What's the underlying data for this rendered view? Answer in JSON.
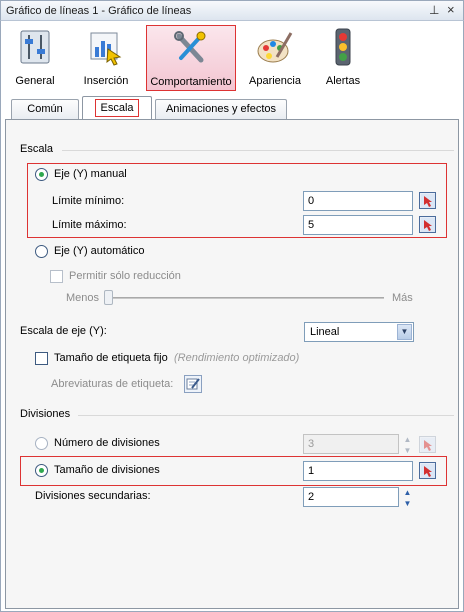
{
  "window": {
    "title": "Gráfico de líneas 1 - Gráfico de líneas",
    "pin_glyph": "⊥",
    "close_glyph": "×"
  },
  "categories": [
    {
      "label": "General",
      "icon": "sliders-icon"
    },
    {
      "label": "Inserción",
      "icon": "insert-chart-icon"
    },
    {
      "label": "Comportamiento",
      "icon": "tools-icon",
      "selected": true
    },
    {
      "label": "Apariencia",
      "icon": "palette-icon"
    },
    {
      "label": "Alertas",
      "icon": "traffic-light-icon"
    }
  ],
  "tabs": [
    {
      "label": "Común"
    },
    {
      "label": "Escala",
      "active": true
    },
    {
      "label": "Animaciones y efectos"
    }
  ],
  "scale": {
    "section_label": "Escala",
    "manual_label": "Eje (Y) manual",
    "manual_selected": true,
    "min_label": "Límite mínimo:",
    "min_value": "0",
    "max_label": "Límite máximo:",
    "max_value": "5",
    "auto_label": "Eje (Y) automático",
    "reduce_label": "Permitir sólo reducción",
    "less_label": "Menos",
    "more_label": "Más",
    "axis_scale_label": "Escala de eje (Y):",
    "axis_scale_value": "Lineal",
    "fixed_label_size_label": "Tamaño de etiqueta fijo",
    "fixed_label_size_note": "(Rendimiento optimizado)",
    "abbreviations_label": "Abreviaturas de etiqueta:"
  },
  "divisions": {
    "section_label": "Divisiones",
    "count_label": "Número de divisiones",
    "count_value": "3",
    "size_label": "Tamaño de divisiones",
    "size_value": "1",
    "size_selected": true,
    "secondary_label": "Divisiones secundarias:",
    "secondary_value": "2"
  },
  "colors": {
    "highlight": "#dd3333",
    "accent": "#2fa84f"
  }
}
